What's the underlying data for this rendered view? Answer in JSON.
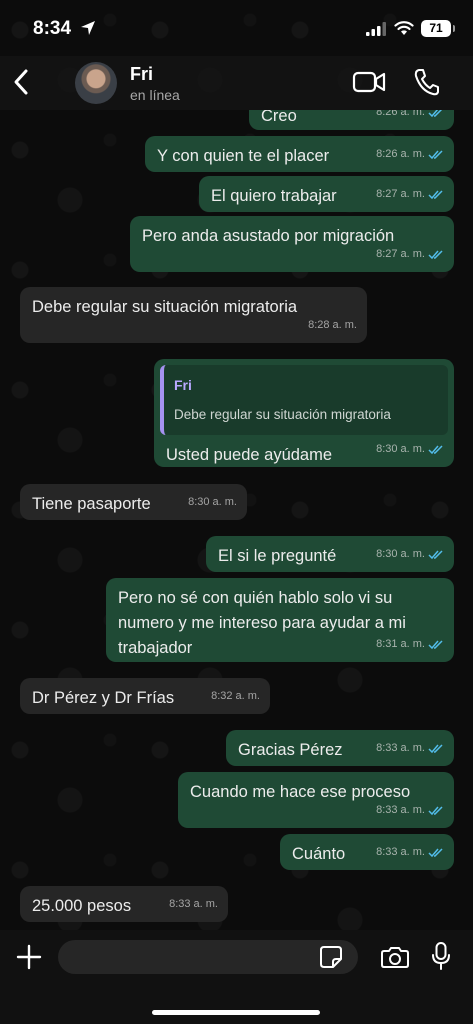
{
  "status_bar": {
    "time": "8:34",
    "battery": "71"
  },
  "header": {
    "name": "Fri",
    "status": "en línea"
  },
  "messages": [
    {
      "dir": "out",
      "text": "Creo",
      "time": "8:26 a. m."
    },
    {
      "dir": "out",
      "text": "Y con quien te el placer",
      "time": "8:26 a. m."
    },
    {
      "dir": "out",
      "text": "El quiero trabajar",
      "time": "8:27 a. m."
    },
    {
      "dir": "out",
      "text": "Pero anda asustado por migración",
      "time": "8:27 a. m."
    },
    {
      "dir": "in",
      "text": "Debe regular su situación migratoria",
      "time": "8:28 a. m."
    },
    {
      "dir": "out",
      "quote_name": "Fri",
      "quote_text": "Debe regular su situación migratoria",
      "text": "Usted puede ayúdame",
      "time": "8:30 a. m."
    },
    {
      "dir": "in",
      "text": "Tiene pasaporte",
      "time": "8:30 a. m."
    },
    {
      "dir": "out",
      "text": "El si le pregunté",
      "time": "8:30 a. m."
    },
    {
      "dir": "out",
      "text": "Pero no sé con quién hablo solo vi su numero y me intereso para ayudar a mi trabajador",
      "time": "8:31 a. m."
    },
    {
      "dir": "in",
      "text": "Dr Pérez y Dr Frías",
      "time": "8:32 a. m."
    },
    {
      "dir": "out",
      "text": "Gracias Pérez",
      "time": "8:33 a. m."
    },
    {
      "dir": "out",
      "text": "Cuando me hace ese proceso",
      "time": "8:33 a. m."
    },
    {
      "dir": "out",
      "text": "Cuánto",
      "time": "8:33 a. m."
    },
    {
      "dir": "in",
      "text": "25.000 pesos",
      "time": "8:33 a. m."
    }
  ],
  "colors": {
    "outgoing_bubble": "#1f4a35",
    "incoming_bubble": "#262626",
    "read_ticks": "#53bdeb",
    "quote_accent": "#a592f0"
  },
  "icons": [
    "back-chevron-icon",
    "video-call-icon",
    "phone-call-icon",
    "plus-icon",
    "sticker-icon",
    "camera-icon",
    "microphone-icon",
    "double-check-icon"
  ]
}
